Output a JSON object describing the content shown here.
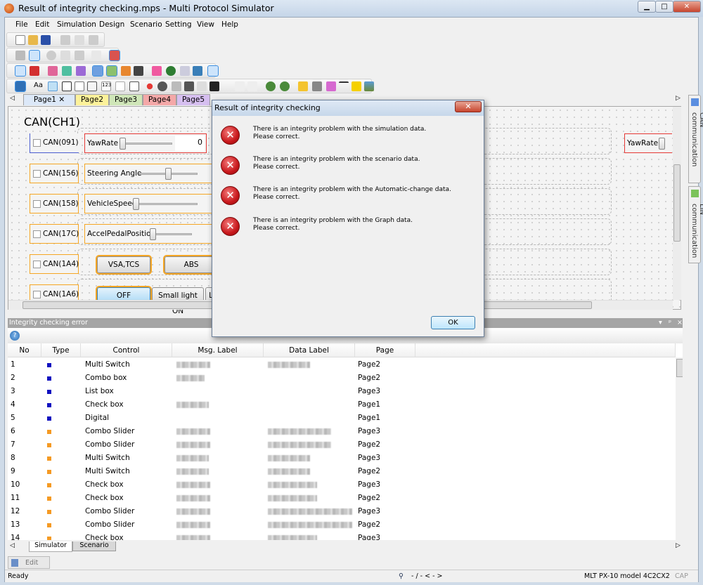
{
  "window": {
    "title": "Result of integrity checking.mps - Multi Protocol Simulator",
    "min": "▁",
    "max": "□",
    "close": "✕"
  },
  "menu": [
    "File",
    "Edit",
    "Simulation",
    "Design",
    "Scenario",
    "Setting",
    "View",
    "Help"
  ],
  "page_tabs": [
    {
      "label": "Page1",
      "color": "#dce8f8",
      "close": "✕"
    },
    {
      "label": "Page2",
      "color": "#fdf29a"
    },
    {
      "label": "Page3",
      "color": "#cfe6b8"
    },
    {
      "label": "Page4",
      "color": "#f4a8a8"
    },
    {
      "label": "Page5",
      "color": "#d6bff0"
    }
  ],
  "canvas": {
    "title": "CAN(CH1)",
    "can_boxes": [
      "CAN(091)",
      "CAN(156)",
      "CAN(158)",
      "CAN(17C)",
      "CAN(1A4)",
      "CAN(1A6)"
    ],
    "sliders": [
      {
        "label": "YawRate",
        "value": "0"
      },
      {
        "label": "Steering Angle"
      },
      {
        "label": "VehicleSpeed"
      },
      {
        "label": "AccelPedalPosition"
      }
    ],
    "buttons": [
      "VSA,TCS",
      "ABS"
    ],
    "switch": [
      "OFF",
      "Small light ON",
      "L"
    ],
    "right_slider": "YawRate"
  },
  "side_tabs": [
    "CAN communication",
    "LIN communication"
  ],
  "panel": {
    "title": "Integrity checking error",
    "columns": [
      "No",
      "Type",
      "Control",
      "Msg. Label",
      "Data Label",
      "Page"
    ],
    "rows": [
      {
        "no": "1",
        "type": "#1010c0",
        "control": "Multi Switch",
        "page": "Page2"
      },
      {
        "no": "2",
        "type": "#1010c0",
        "control": "Combo box",
        "page": "Page2"
      },
      {
        "no": "3",
        "type": "#1010c0",
        "control": "List box",
        "page": "Page3"
      },
      {
        "no": "4",
        "type": "#1010c0",
        "control": "Check box",
        "page": "Page1"
      },
      {
        "no": "5",
        "type": "#1010c0",
        "control": "Digital",
        "page": "Page1"
      },
      {
        "no": "6",
        "type": "#f59a23",
        "control": "Combo Slider",
        "page": "Page3"
      },
      {
        "no": "7",
        "type": "#f59a23",
        "control": "Combo Slider",
        "page": "Page2"
      },
      {
        "no": "8",
        "type": "#f59a23",
        "control": "Multi Switch",
        "page": "Page3"
      },
      {
        "no": "9",
        "type": "#f59a23",
        "control": "Multi Switch",
        "page": "Page2"
      },
      {
        "no": "10",
        "type": "#f59a23",
        "control": "Check box",
        "page": "Page3"
      },
      {
        "no": "11",
        "type": "#f59a23",
        "control": "Check box",
        "page": "Page2"
      },
      {
        "no": "12",
        "type": "#f59a23",
        "control": "Combo Slider",
        "page": "Page3"
      },
      {
        "no": "13",
        "type": "#f59a23",
        "control": "Combo Slider",
        "page": "Page2"
      },
      {
        "no": "14",
        "type": "#f59a23",
        "control": "Check box",
        "page": "Page3"
      }
    ]
  },
  "bottom_tabs": [
    "Simulator",
    "Scenario"
  ],
  "edit_tab": "Edit",
  "status": {
    "text": "Ready",
    "nav": "- / - < - >",
    "model": "MLT PX-10 model 4C2CX2",
    "cap": "CAP"
  },
  "dialog": {
    "title": "Result of integrity checking",
    "close": "✕",
    "messages": [
      {
        "line1": "There is an integrity problem with the simulation data.",
        "line2": "Please correct."
      },
      {
        "line1": "There is an integrity problem with the scenario data.",
        "line2": "Please correct."
      },
      {
        "line1": "There is an integrity problem with the Automatic-change data.",
        "line2": "Please correct."
      },
      {
        "line1": "There is an integrity problem with the Graph data.",
        "line2": "Please correct."
      }
    ],
    "ok": "OK"
  }
}
